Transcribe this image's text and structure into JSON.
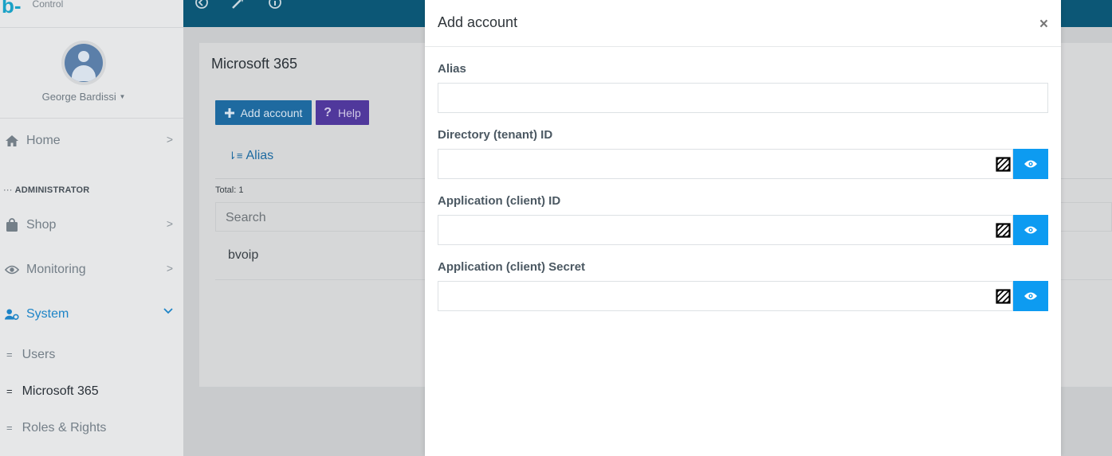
{
  "brand": {
    "logo_text": "b-",
    "sub_text": "Control"
  },
  "user": {
    "name": "George Bardissi"
  },
  "sidebar": {
    "home": {
      "label": "Home"
    },
    "section_label": "ADMINISTRATOR",
    "shop": {
      "label": "Shop"
    },
    "monitoring": {
      "label": "Monitoring"
    },
    "system": {
      "label": "System"
    },
    "sub_items": [
      {
        "label": "Users"
      },
      {
        "label": "Microsoft 365"
      },
      {
        "label": "Roles & Rights"
      }
    ]
  },
  "page": {
    "title": "Microsoft 365",
    "add_button_label": "Add account",
    "help_button_label": "Help",
    "column_alias": "Alias",
    "total_label": "Total: 1",
    "search_placeholder": "Search",
    "rows": [
      {
        "alias": "bvoip"
      }
    ]
  },
  "modal": {
    "title": "Add account",
    "close_glyph": "×",
    "fields": {
      "alias": {
        "label": "Alias",
        "value": ""
      },
      "tenant_id": {
        "label": "Directory (tenant) ID",
        "value": ""
      },
      "client_id": {
        "label": "Application (client) ID",
        "value": ""
      },
      "client_secret": {
        "label": "Application (client) Secret",
        "value": ""
      }
    }
  },
  "colors": {
    "accent": "#0d9bf1",
    "topbar": "#0c5776",
    "sidebar_active": "#1d84c7",
    "help_button": "#50389c"
  },
  "icons": [
    "home-icon",
    "shopping-bag-icon",
    "eye-icon",
    "users-cog-icon",
    "chevron-right-icon",
    "chevron-down-icon",
    "plus-icon",
    "question-icon",
    "sort-icon",
    "close-icon",
    "password-mask-icon",
    "avatar-icon"
  ]
}
